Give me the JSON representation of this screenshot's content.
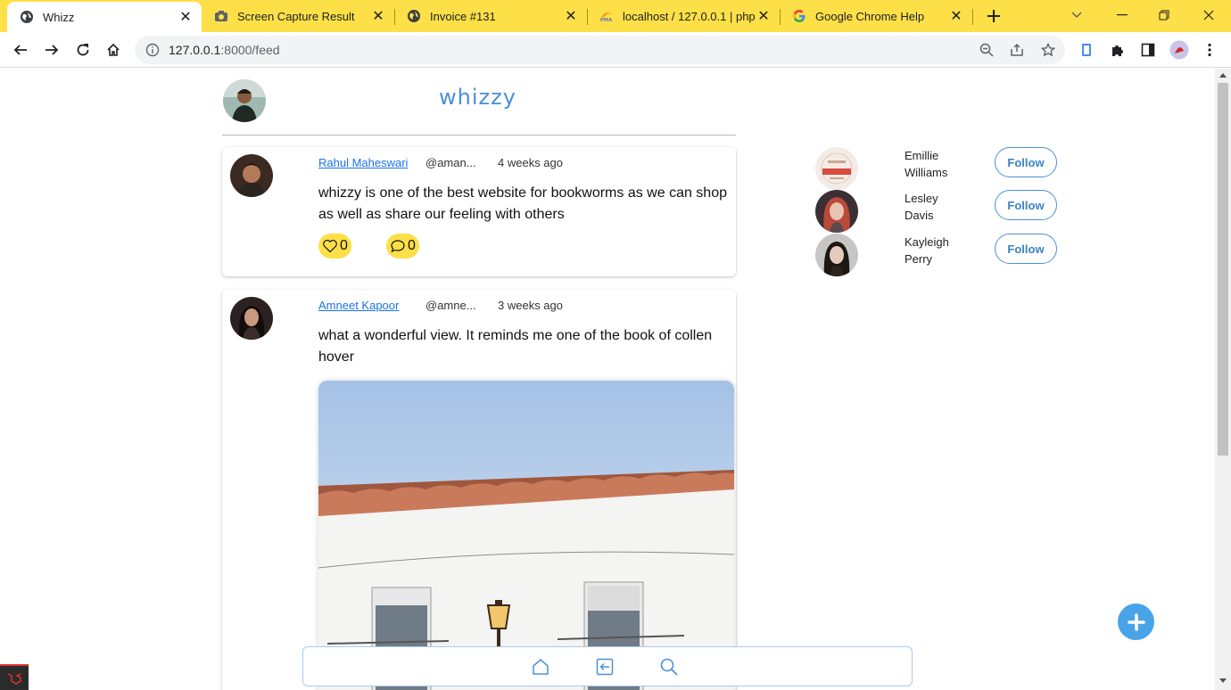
{
  "browser": {
    "tabs": [
      {
        "title": "Whizz",
        "icon": "globe-icon",
        "active": true
      },
      {
        "title": "Screen Capture Result",
        "icon": "camera-icon",
        "active": false
      },
      {
        "title": "Invoice #131",
        "icon": "globe-icon",
        "active": false
      },
      {
        "title": "localhost / 127.0.0.1 | php",
        "icon": "phpmyadmin-icon",
        "active": false
      },
      {
        "title": "Google Chrome Help",
        "icon": "google-icon",
        "active": false
      }
    ],
    "url_host": "127.0.0.1",
    "url_path": ":8000/feed"
  },
  "app": {
    "logo": "whizzy"
  },
  "posts": [
    {
      "name": "Rahul Maheswari",
      "handle": "@aman...",
      "time": "4 weeks ago",
      "text": "whizzy is one of the best website for bookworms as we can shop as well as share our feeling with others",
      "likes": "0",
      "comments": "0"
    },
    {
      "name": "Amneet Kapoor",
      "handle": "@amne...",
      "time": "3 weeks ago",
      "text": "what a wonderful view. It reminds me one of the book of collen hover"
    }
  ],
  "suggestions": [
    {
      "first": "Emillie",
      "last": "Williams",
      "button": "Follow"
    },
    {
      "first": "Lesley",
      "last": "Davis",
      "button": "Follow"
    },
    {
      "first": "Kayleigh",
      "last": "Perry",
      "button": "Follow"
    }
  ],
  "colors": {
    "tabstrip": "#fde047",
    "accent": "#4a90d9",
    "reaction": "#fde047",
    "link": "#1a73e8"
  }
}
